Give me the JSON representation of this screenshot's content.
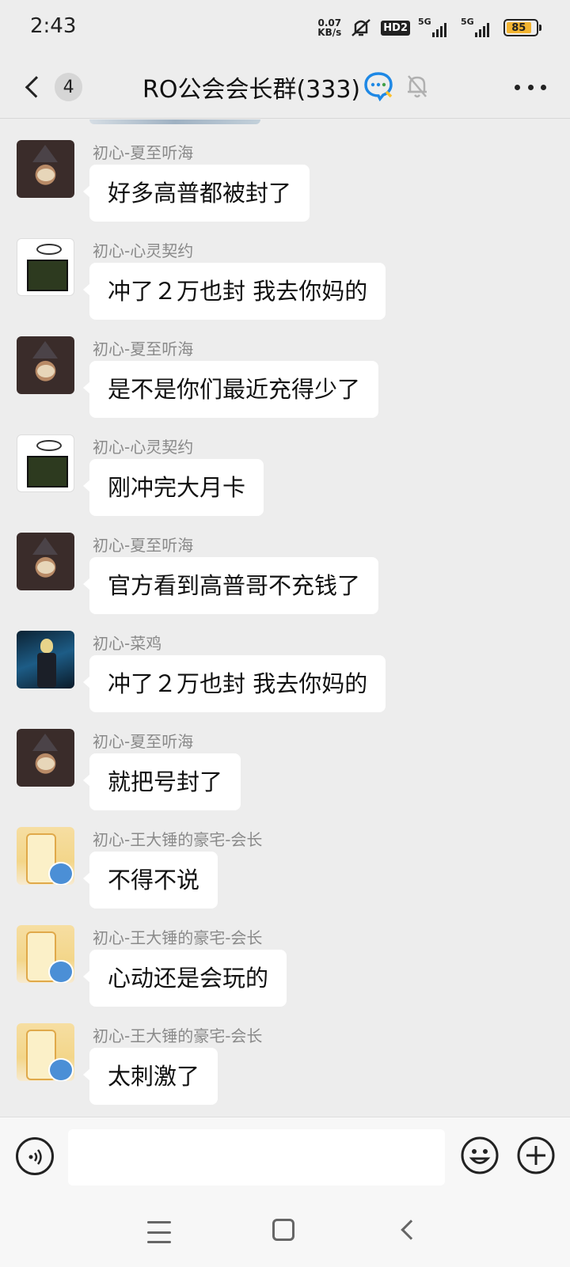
{
  "status_bar": {
    "time": "2:43",
    "net_speed_value": "0.07",
    "net_speed_unit": "KB/s",
    "hd_label": "HD2",
    "sim1_label": "5G",
    "sim2_label": "5G",
    "battery_level": "85"
  },
  "header": {
    "unread_count": "4",
    "title": "RO公会会长群(333)"
  },
  "messages": [
    {
      "sender": "初心-夏至听海",
      "text": "好多高普都被封了",
      "avatar": "wizard"
    },
    {
      "sender": "初心-心灵契约",
      "text": "冲了２万也封 我去你妈的",
      "avatar": "cartoon"
    },
    {
      "sender": "初心-夏至听海",
      "text": "是不是你们最近充得少了",
      "avatar": "wizard"
    },
    {
      "sender": "初心-心灵契约",
      "text": "刚冲完大月卡",
      "avatar": "cartoon"
    },
    {
      "sender": "初心-夏至听海",
      "text": "官方看到高普哥不充钱了",
      "avatar": "wizard"
    },
    {
      "sender": "初心-菜鸡",
      "text": "冲了２万也封 我去你妈的",
      "avatar": "warrior"
    },
    {
      "sender": "初心-夏至听海",
      "text": "就把号封了",
      "avatar": "wizard"
    },
    {
      "sender": "初心-王大锤的豪宅-会长",
      "text": "不得不说",
      "avatar": "drink"
    },
    {
      "sender": "初心-王大锤的豪宅-会长",
      "text": "心动还是会玩的",
      "avatar": "drink"
    },
    {
      "sender": "初心-王大锤的豪宅-会长",
      "text": "太刺激了",
      "avatar": "drink"
    }
  ],
  "input_bar": {
    "text_value": "",
    "placeholder": ""
  },
  "icons": {
    "voice": "voice-icon",
    "emoji": "emoji-icon",
    "plus": "plus-icon",
    "group": "group-chat-icon",
    "mute": "mute-bell-icon",
    "more": "more-icon"
  }
}
